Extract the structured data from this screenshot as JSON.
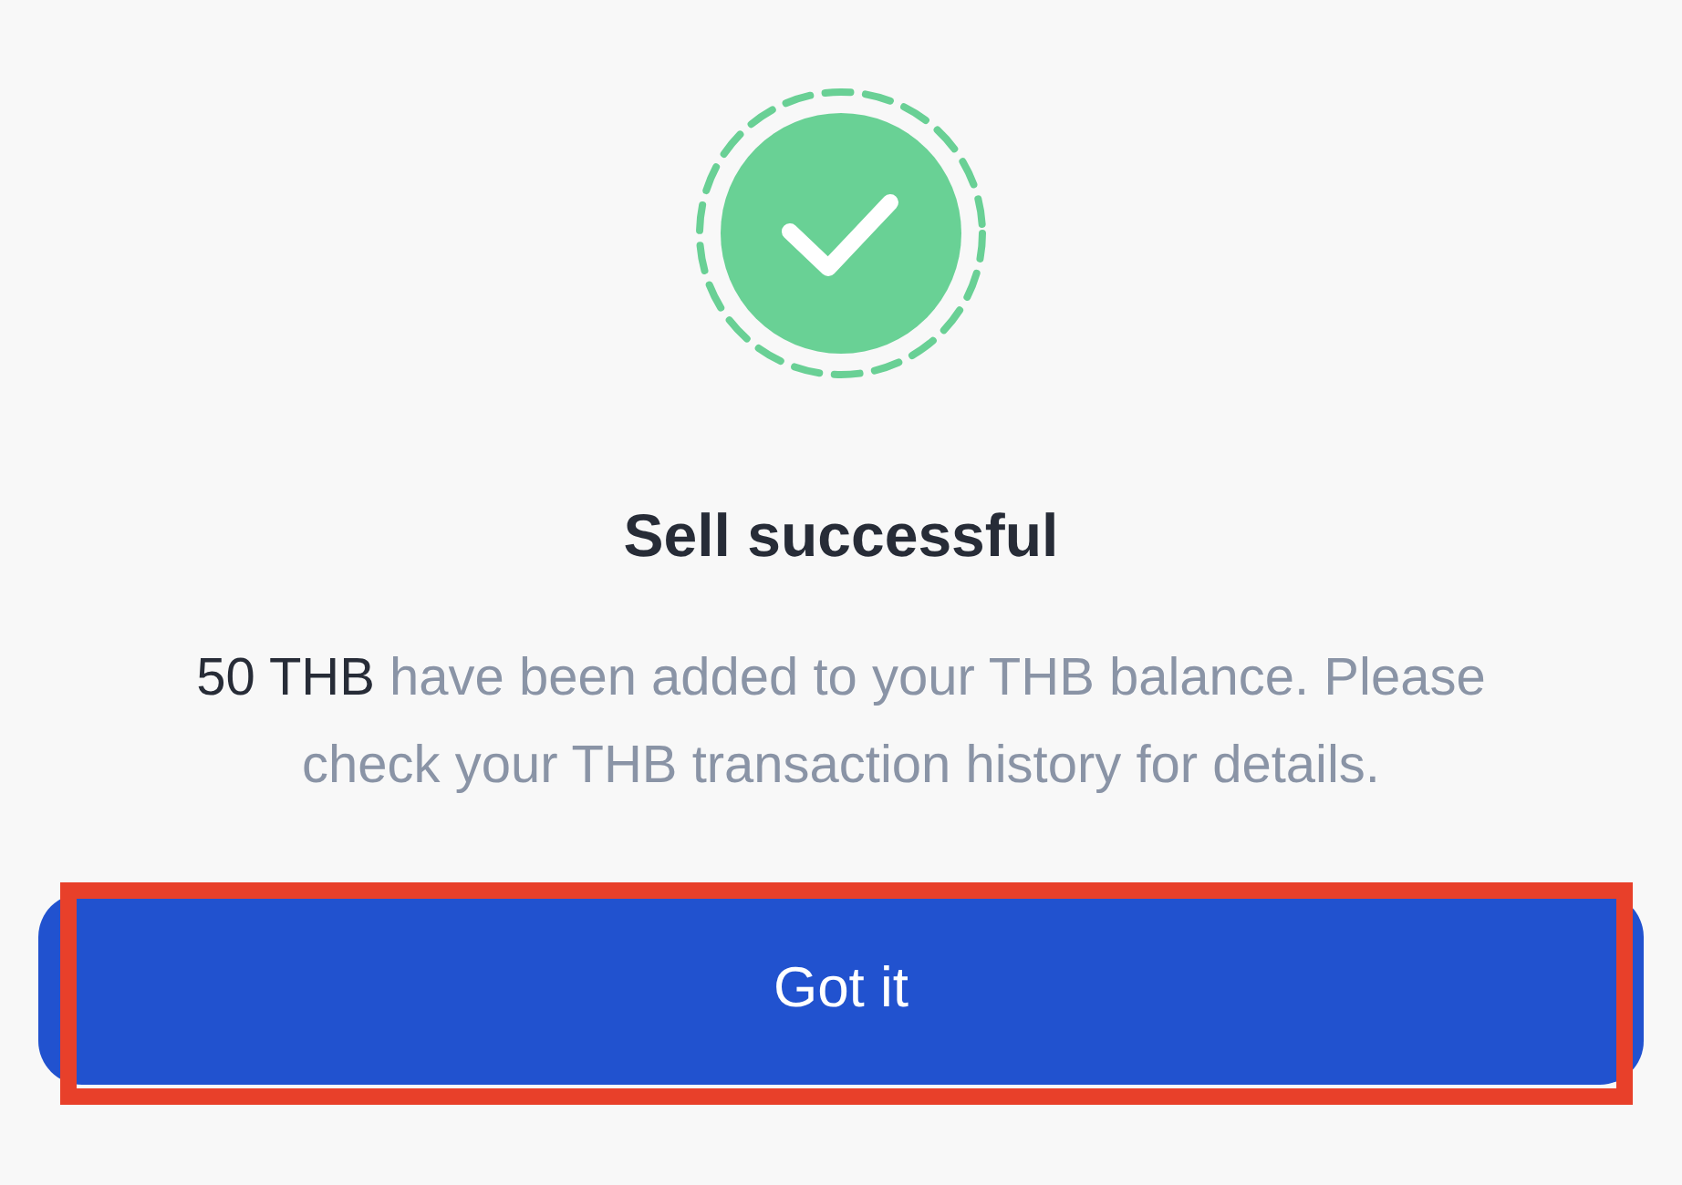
{
  "title": "Sell successful",
  "message": "**50 THB** have been added to your THB balance. Please check your THB transaction history for details.",
  "button": {
    "label": "Got it",
    "highlighted": true
  }
}
